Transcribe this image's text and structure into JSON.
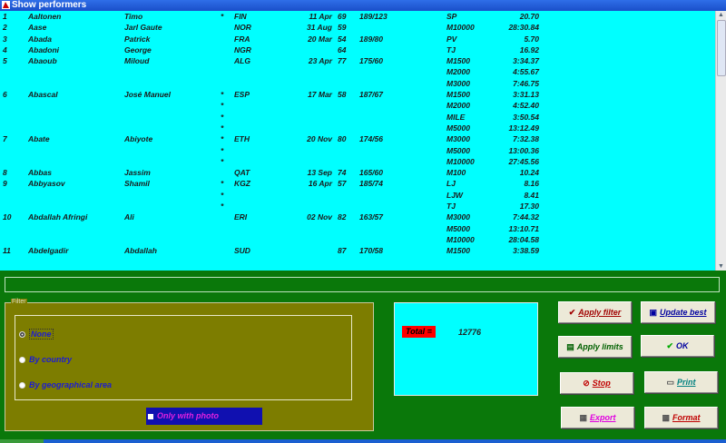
{
  "window": {
    "title": "Show performers"
  },
  "performers": [
    {
      "num": "1",
      "last": "Aaltonen",
      "first": "Timo",
      "star": "*",
      "country": "FIN",
      "date": "11 Apr",
      "year": "69",
      "hw": "189/123",
      "event": "SP",
      "mark": "20.70"
    },
    {
      "num": "2",
      "last": "Aase",
      "first": "Jarl Gaute",
      "star": "",
      "country": "NOR",
      "date": "31 Aug",
      "year": "59",
      "hw": "",
      "event": "M10000",
      "mark": "28:30.84"
    },
    {
      "num": "3",
      "last": "Abada",
      "first": "Patrick",
      "star": "",
      "country": "FRA",
      "date": "20 Mar",
      "year": "54",
      "hw": "189/80",
      "event": "PV",
      "mark": "5.70"
    },
    {
      "num": "4",
      "last": "Abadoni",
      "first": "George",
      "star": "",
      "country": "NGR",
      "date": "",
      "year": "64",
      "hw": "",
      "event": "TJ",
      "mark": "16.92"
    },
    {
      "num": "5",
      "last": "Abaoub",
      "first": "Miloud",
      "star": "",
      "country": "ALG",
      "date": "23 Apr",
      "year": "77",
      "hw": "175/60",
      "event": "M1500",
      "mark": "3:34.37"
    },
    {
      "num": "",
      "last": "",
      "first": "",
      "star": "",
      "country": "",
      "date": "",
      "year": "",
      "hw": "",
      "event": "M2000",
      "mark": "4:55.67"
    },
    {
      "num": "",
      "last": "",
      "first": "",
      "star": "",
      "country": "",
      "date": "",
      "year": "",
      "hw": "",
      "event": "M3000",
      "mark": "7:46.75"
    },
    {
      "num": "6",
      "last": "Abascal",
      "first": "José Manuel",
      "star": "*",
      "country": "ESP",
      "date": "17 Mar",
      "year": "58",
      "hw": "187/67",
      "event": "M1500",
      "mark": "3:31.13"
    },
    {
      "num": "",
      "last": "",
      "first": "",
      "star": "*",
      "country": "",
      "date": "",
      "year": "",
      "hw": "",
      "event": "M2000",
      "mark": "4:52.40"
    },
    {
      "num": "",
      "last": "",
      "first": "",
      "star": "*",
      "country": "",
      "date": "",
      "year": "",
      "hw": "",
      "event": "MILE",
      "mark": "3:50.54"
    },
    {
      "num": "",
      "last": "",
      "first": "",
      "star": "*",
      "country": "",
      "date": "",
      "year": "",
      "hw": "",
      "event": "M5000",
      "mark": "13:12.49"
    },
    {
      "num": "7",
      "last": "Abate",
      "first": "Abiyote",
      "star": "*",
      "country": "ETH",
      "date": "20 Nov",
      "year": "80",
      "hw": "174/56",
      "event": "M3000",
      "mark": "7:32.38"
    },
    {
      "num": "",
      "last": "",
      "first": "",
      "star": "*",
      "country": "",
      "date": "",
      "year": "",
      "hw": "",
      "event": "M5000",
      "mark": "13:00.36"
    },
    {
      "num": "",
      "last": "",
      "first": "",
      "star": "*",
      "country": "",
      "date": "",
      "year": "",
      "hw": "",
      "event": "M10000",
      "mark": "27:45.56"
    },
    {
      "num": "8",
      "last": "Abbas",
      "first": "Jassim",
      "star": "",
      "country": "QAT",
      "date": "13 Sep",
      "year": "74",
      "hw": "165/60",
      "event": "M100",
      "mark": "10.24"
    },
    {
      "num": "9",
      "last": "Abbyasov",
      "first": "Shamil",
      "star": "*",
      "country": "KGZ",
      "date": "16 Apr",
      "year": "57",
      "hw": "185/74",
      "event": "LJ",
      "mark": "8.16"
    },
    {
      "num": "",
      "last": "",
      "first": "",
      "star": "*",
      "country": "",
      "date": "",
      "year": "",
      "hw": "",
      "event": "LJW",
      "mark": "8.41"
    },
    {
      "num": "",
      "last": "",
      "first": "",
      "star": "*",
      "country": "",
      "date": "",
      "year": "",
      "hw": "",
      "event": "TJ",
      "mark": "17.30"
    },
    {
      "num": "10",
      "last": "Abdallah Afringi",
      "first": "Ali",
      "star": "",
      "country": "ERI",
      "date": "02 Nov",
      "year": "82",
      "hw": "163/57",
      "event": "M3000",
      "mark": "7:44.32"
    },
    {
      "num": "",
      "last": "",
      "first": "",
      "star": "",
      "country": "",
      "date": "",
      "year": "",
      "hw": "",
      "event": "M5000",
      "mark": "13:10.71"
    },
    {
      "num": "",
      "last": "",
      "first": "",
      "star": "",
      "country": "",
      "date": "",
      "year": "",
      "hw": "",
      "event": "M10000",
      "mark": "28:04.58"
    },
    {
      "num": "11",
      "last": "Abdelgadir",
      "first": "Abdallah",
      "star": "",
      "country": "SUD",
      "date": "",
      "year": "87",
      "hw": "170/58",
      "event": "M1500",
      "mark": "3:38.59"
    }
  ],
  "filter": {
    "legend": "Filter",
    "options": [
      "None",
      "By country",
      "By geographical area"
    ],
    "selected": "None",
    "only_photo_label": "Only with photo"
  },
  "total": {
    "label": "Total =",
    "value": "12776"
  },
  "buttons": {
    "apply_filter": "Apply filter",
    "update_best": "Update best",
    "apply_limits": "Apply limits",
    "ok": "OK",
    "stop": "Stop",
    "print": "Print",
    "export": "Export",
    "format": "Format"
  },
  "colors": {
    "background": "#0a780a",
    "list": "#00ffff",
    "filter_panel": "#7d7d00",
    "total_label": "#ff0000"
  },
  "icons": {
    "title": "app-icon",
    "apply": "checkmark-icon",
    "update": "update-icon",
    "limits": "limits-icon",
    "ok": "checkmark-icon",
    "stop": "stop-icon",
    "print": "printer-icon",
    "export": "export-icon",
    "format": "format-icon"
  }
}
